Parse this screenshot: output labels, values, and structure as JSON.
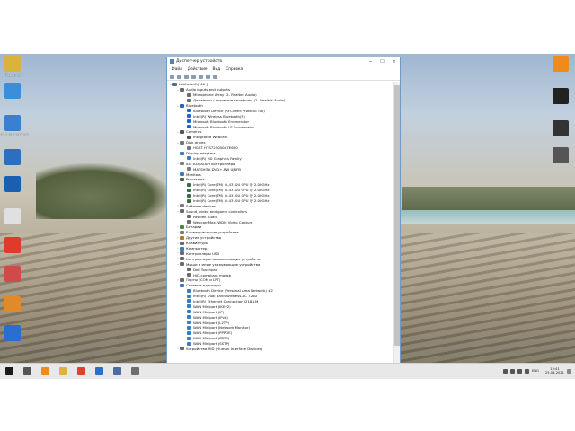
{
  "window": {
    "title": "Диспетчер устройств",
    "minimize": "─",
    "maximize": "☐",
    "close": "✕"
  },
  "menu": [
    "Файл",
    "Действие",
    "Вид",
    "Справка"
  ],
  "tree": [
    {
      "level": 0,
      "exp": "⌄",
      "text": "Latitude-E-[ 40 ]",
      "icon": "computer",
      "color": "#4a6da0"
    },
    {
      "level": 1,
      "exp": "⌄",
      "text": "Audio inputs and outputs",
      "icon": "audio",
      "color": "#6b6b6b"
    },
    {
      "level": 2,
      "exp": "",
      "text": "Microphone Array (2- Realtek Audio)",
      "icon": "mic",
      "color": "#6b6b6b"
    },
    {
      "level": 2,
      "exp": "",
      "text": "Динамики / головные телефоны (2- Realtek Audio)",
      "icon": "speaker",
      "color": "#6b6b6b"
    },
    {
      "level": 1,
      "exp": "⌄",
      "text": "Bluetooth",
      "icon": "bluetooth",
      "color": "#2563c9"
    },
    {
      "level": 2,
      "exp": "",
      "text": "Bluetooth Device (RFCOMM Protocol TDI)",
      "icon": "bluetooth",
      "color": "#2563c9"
    },
    {
      "level": 2,
      "exp": "",
      "text": "Intel(R) Wireless Bluetooth(R)",
      "icon": "bluetooth",
      "color": "#2563c9"
    },
    {
      "level": 2,
      "exp": "",
      "text": "Microsoft Bluetooth Enumerator",
      "icon": "bluetooth",
      "color": "#2563c9"
    },
    {
      "level": 2,
      "exp": "",
      "text": "Microsoft Bluetooth LE Enumerator",
      "icon": "bluetooth",
      "color": "#2563c9"
    },
    {
      "level": 1,
      "exp": "⌄",
      "text": "Cameras",
      "icon": "camera",
      "color": "#555"
    },
    {
      "level": 2,
      "exp": "",
      "text": "Integrated Webcam",
      "icon": "camera",
      "color": "#555"
    },
    {
      "level": 1,
      "exp": "⌄",
      "text": "Disk drives",
      "icon": "disk",
      "color": "#777"
    },
    {
      "level": 2,
      "exp": "",
      "text": "HGST HTS725050A7E630",
      "icon": "disk",
      "color": "#777"
    },
    {
      "level": 1,
      "exp": "⌄",
      "text": "Display adapters",
      "icon": "display",
      "color": "#3b7bbf"
    },
    {
      "level": 2,
      "exp": "",
      "text": "Intel(R) HD Graphics Family",
      "icon": "display",
      "color": "#3b7bbf"
    },
    {
      "level": 1,
      "exp": "⌄",
      "text": "IDE ATA/ATAPI контроллеры",
      "icon": "ide",
      "color": "#7d7d7d"
    },
    {
      "level": 2,
      "exp": "",
      "text": "MATSHITA DVD+-RW UJ8FB",
      "icon": "dvd",
      "color": "#7d7d7d"
    },
    {
      "level": 1,
      "exp": "›",
      "text": "Monitors",
      "icon": "monitor",
      "color": "#3b7bbf"
    },
    {
      "level": 1,
      "exp": "⌄",
      "text": "Processors",
      "icon": "cpu",
      "color": "#3a6b45"
    },
    {
      "level": 2,
      "exp": "",
      "text": "Intel(R) Core(TM) i5-4310U CPU @ 2.00GHz",
      "icon": "cpu",
      "color": "#3a6b45"
    },
    {
      "level": 2,
      "exp": "",
      "text": "Intel(R) Core(TM) i5-4310U CPU @ 2.00GHz",
      "icon": "cpu",
      "color": "#3a6b45"
    },
    {
      "level": 2,
      "exp": "",
      "text": "Intel(R) Core(TM) i5-4310U CPU @ 2.00GHz",
      "icon": "cpu",
      "color": "#3a6b45"
    },
    {
      "level": 2,
      "exp": "",
      "text": "Intel(R) Core(TM) i5-4310U CPU @ 2.00GHz",
      "icon": "cpu",
      "color": "#3a6b45"
    },
    {
      "level": 1,
      "exp": "›",
      "text": "Software devices",
      "icon": "software",
      "color": "#7d7d7d"
    },
    {
      "level": 1,
      "exp": "⌄",
      "text": "Sound, video and game controllers",
      "icon": "sound",
      "color": "#6b6b6b"
    },
    {
      "level": 2,
      "exp": "",
      "text": "Realtek Audio",
      "icon": "sound",
      "color": "#6b6b6b"
    },
    {
      "level": 2,
      "exp": "",
      "text": "WebcamMax, WDM Video Capture",
      "icon": "sound",
      "color": "#6b6b6b"
    },
    {
      "level": 1,
      "exp": "›",
      "text": "Батареи",
      "icon": "battery",
      "color": "#4a8a3a"
    },
    {
      "level": 1,
      "exp": "›",
      "text": "Биометрические устройства",
      "icon": "biometric",
      "color": "#7d7d7d"
    },
    {
      "level": 1,
      "exp": "›",
      "text": "Другие устройства",
      "icon": "other",
      "color": "#b07a20"
    },
    {
      "level": 1,
      "exp": "›",
      "text": "Клавиатуры",
      "icon": "keyboard",
      "color": "#6b6b6b"
    },
    {
      "level": 1,
      "exp": "›",
      "text": "Компьютер",
      "icon": "computer",
      "color": "#3b7bbf"
    },
    {
      "level": 1,
      "exp": "›",
      "text": "Контроллеры USB",
      "icon": "usb",
      "color": "#6b6b6b"
    },
    {
      "level": 1,
      "exp": "›",
      "text": "Контроллеры запоминающих устройств",
      "icon": "storage",
      "color": "#6b6b6b"
    },
    {
      "level": 1,
      "exp": "⌄",
      "text": "Мыши и иные указывающие устройства",
      "icon": "mouse",
      "color": "#6b6b6b"
    },
    {
      "level": 2,
      "exp": "",
      "text": "Dell Touchpad",
      "icon": "mouse",
      "color": "#6b6b6b"
    },
    {
      "level": 2,
      "exp": "",
      "text": "HID-compliant mouse",
      "icon": "mouse",
      "color": "#6b6b6b"
    },
    {
      "level": 1,
      "exp": "›",
      "text": "Порты (COM и LPT)",
      "icon": "port",
      "color": "#6b6b6b"
    },
    {
      "level": 1,
      "exp": "⌄",
      "text": "Сетевые адаптеры",
      "icon": "network",
      "color": "#3b7bbf"
    },
    {
      "level": 2,
      "exp": "",
      "text": "Bluetooth Device (Personal Area Network) #2",
      "icon": "network",
      "color": "#3b7bbf"
    },
    {
      "level": 2,
      "exp": "",
      "text": "Intel(R) Dual Band Wireless-AC 7260",
      "icon": "network",
      "color": "#3b7bbf"
    },
    {
      "level": 2,
      "exp": "",
      "text": "Intel(R) Ethernet Connection I218-LM",
      "icon": "network",
      "color": "#3b7bbf"
    },
    {
      "level": 2,
      "exp": "",
      "text": "WAN Miniport (IKEv2)",
      "icon": "network",
      "color": "#3b7bbf"
    },
    {
      "level": 2,
      "exp": "",
      "text": "WAN Miniport (IP)",
      "icon": "network",
      "color": "#3b7bbf"
    },
    {
      "level": 2,
      "exp": "",
      "text": "WAN Miniport (IPv6)",
      "icon": "network",
      "color": "#3b7bbf"
    },
    {
      "level": 2,
      "exp": "",
      "text": "WAN Miniport (L2TP)",
      "icon": "network",
      "color": "#3b7bbf"
    },
    {
      "level": 2,
      "exp": "",
      "text": "WAN Miniport (Network Monitor)",
      "icon": "network",
      "color": "#3b7bbf"
    },
    {
      "level": 2,
      "exp": "",
      "text": "WAN Miniport (PPPOE)",
      "icon": "network",
      "color": "#3b7bbf"
    },
    {
      "level": 2,
      "exp": "",
      "text": "WAN Miniport (PPTP)",
      "icon": "network",
      "color": "#3b7bbf"
    },
    {
      "level": 2,
      "exp": "",
      "text": "WAN Miniport (SSTP)",
      "icon": "network",
      "color": "#3b7bbf"
    },
    {
      "level": 1,
      "exp": "›",
      "text": "Устройства HID (Human Interface Devices)",
      "icon": "hid",
      "color": "#6b6b6b"
    }
  ],
  "desktop_left": [
    {
      "label": "Корзина",
      "color": "#d8b43a"
    },
    {
      "label": "",
      "color": "#3a8fd8"
    },
    {
      "label": "Этот компьютер",
      "color": "#3a7fd0"
    },
    {
      "label": "",
      "color": "#2d6fbf"
    },
    {
      "label": "",
      "color": "#1a5fb0"
    },
    {
      "label": "",
      "color": "#e0e0e0"
    },
    {
      "label": "",
      "color": "#e03a2a"
    },
    {
      "label": "",
      "color": "#d04a4a"
    },
    {
      "label": "",
      "color": "#e08a2a"
    },
    {
      "label": "",
      "color": "#2a6fd0"
    }
  ],
  "desktop_right": [
    {
      "label": "",
      "color": "#f08a1a"
    },
    {
      "label": "",
      "color": "#222222"
    },
    {
      "label": "",
      "color": "#333333"
    },
    {
      "label": "",
      "color": "#555555"
    }
  ],
  "taskbar": {
    "items": [
      {
        "name": "start-button",
        "color": "#1a1a1a"
      },
      {
        "name": "search-button",
        "color": "#555555"
      },
      {
        "name": "vlc-taskbar",
        "color": "#f08a1a"
      },
      {
        "name": "explorer-taskbar",
        "color": "#e0b040"
      },
      {
        "name": "chrome-taskbar",
        "color": "#e04030"
      },
      {
        "name": "aida64-taskbar",
        "color": "#2a6fd0"
      },
      {
        "name": "app-taskbar",
        "color": "#4a6da0"
      },
      {
        "name": "device-manager-taskbar",
        "color": "#6d6d6d"
      }
    ],
    "lang": "ENG",
    "time": "13:41",
    "date": "25.04.2021"
  }
}
